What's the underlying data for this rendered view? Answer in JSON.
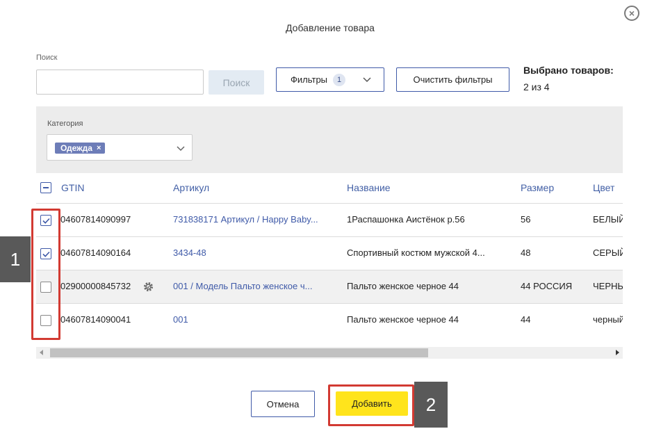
{
  "dialog": {
    "title": "Добавление товара",
    "close_icon": "close-circle-icon"
  },
  "search": {
    "label": "Поиск",
    "value": "",
    "placeholder": "",
    "button_label": "Поиск"
  },
  "filters": {
    "label": "Фильтры",
    "count": "1",
    "clear_label": "Очистить фильтры"
  },
  "selection": {
    "label": "Выбрано товаров:",
    "value": "2 из 4"
  },
  "category": {
    "label": "Категория",
    "tag": "Одежда",
    "tag_remove": "×"
  },
  "table": {
    "columns": [
      "GTIN",
      "Артикул",
      "Название",
      "Размер",
      "Цвет"
    ],
    "rows": [
      {
        "checked": true,
        "gtin": "04607814090997",
        "article": "731838171 Артикул / Happy Baby...",
        "name": "1Распашонка Аистёнок р.56",
        "size": "56",
        "color": "БЕЛЫЙ"
      },
      {
        "checked": true,
        "gtin": "04607814090164",
        "article": "3434-48",
        "name": "Спортивный костюм мужской 4...",
        "size": "48",
        "color": "СЕРЫЙ"
      },
      {
        "checked": false,
        "gtin": "02900000845732",
        "article": "001 / Модель Пальто женское ч...",
        "name": "Пальто женское черное 44",
        "size": "44 РОССИЯ",
        "color": "ЧЕРНЫЙ"
      },
      {
        "checked": false,
        "gtin": "04607814090041",
        "article": "001",
        "name": "Пальто женское черное 44",
        "size": "44",
        "color": "черный"
      }
    ]
  },
  "footer": {
    "cancel_label": "Отмена",
    "add_label": "Добавить"
  },
  "annotations": {
    "marker_1": "1",
    "marker_2": "2",
    "highlight_color": "#d23a32"
  },
  "colors": {
    "accent": "#3f5aa8",
    "primary_button": "#ffe41c",
    "tag": "#6d7db8"
  }
}
